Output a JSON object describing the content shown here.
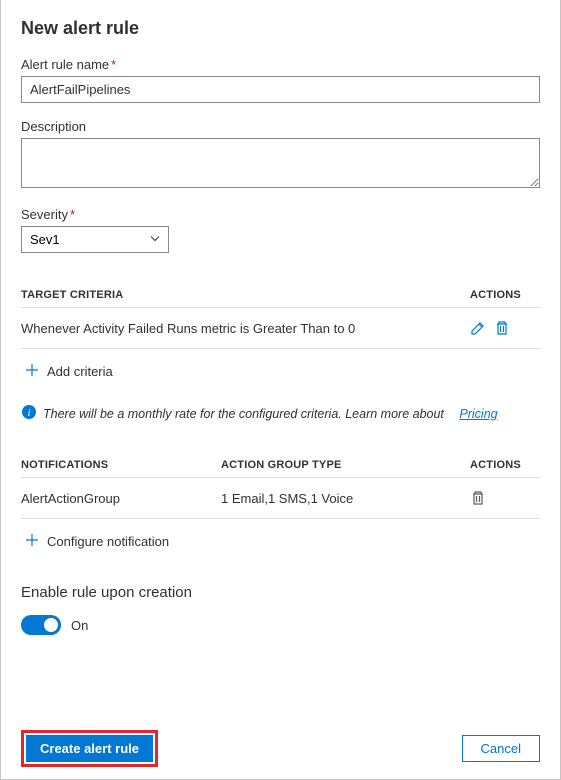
{
  "panel": {
    "title": "New alert rule"
  },
  "fields": {
    "name": {
      "label": "Alert rule name",
      "value": "AlertFailPipelines"
    },
    "description": {
      "label": "Description",
      "value": ""
    },
    "severity": {
      "label": "Severity",
      "value": "Sev1"
    }
  },
  "criteria": {
    "header_main": "TARGET CRITERIA",
    "header_actions": "ACTIONS",
    "rows": [
      {
        "text": "Whenever Activity Failed Runs metric is Greater Than to 0"
      }
    ],
    "add_label": "Add criteria",
    "info_text": "There will be a monthly rate for the configured criteria. Learn more about",
    "info_link": "Pricing"
  },
  "notifications": {
    "header_name": "NOTIFICATIONS",
    "header_type": "ACTION GROUP TYPE",
    "header_actions": "ACTIONS",
    "rows": [
      {
        "name": "AlertActionGroup",
        "type": "1 Email,1 SMS,1 Voice"
      }
    ],
    "configure_label": "Configure notification"
  },
  "enable": {
    "label": "Enable rule upon creation",
    "state": "On"
  },
  "footer": {
    "create": "Create alert rule",
    "cancel": "Cancel"
  }
}
